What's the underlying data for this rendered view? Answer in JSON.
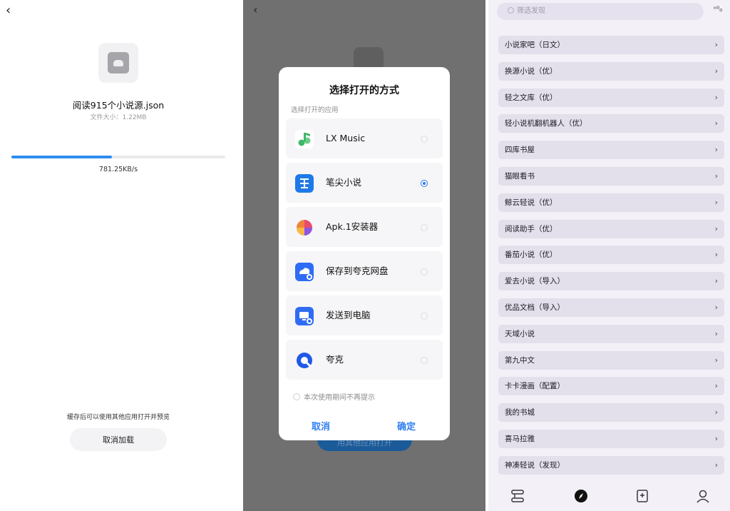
{
  "download": {
    "back_icon": "‹",
    "file_name": "阅读915个小说源.json",
    "file_size": "文件大小：1.22MB",
    "progress": 0.47,
    "speed": "781.25KB/s",
    "hint": "缓存后可以使用其他应用打开并预览",
    "cancel_label": "取消加载"
  },
  "chooser": {
    "back_icon": "‹",
    "background_button_label": "用其他应用打开",
    "title": "选择打开的方式",
    "subtitle": "选择打开的应用",
    "apps": [
      {
        "name": "LX Music",
        "icon": "lx-music-icon",
        "color": "#3fb76b",
        "selected": false
      },
      {
        "name": "笔尖小说",
        "icon": "bijian-novel-icon",
        "color": "#1f7ae8",
        "selected": true
      },
      {
        "name": "Apk.1安装器",
        "icon": "apk-installer-icon",
        "color": "#f0823c",
        "selected": false
      },
      {
        "name": "保存到夸克网盘",
        "icon": "quark-cloud-icon",
        "color": "#2f6cf5",
        "selected": false
      },
      {
        "name": "发送到电脑",
        "icon": "send-to-pc-icon",
        "color": "#2f6cf5",
        "selected": false
      },
      {
        "name": "夸克",
        "icon": "quark-icon",
        "color": "#1e59e8",
        "selected": false
      }
    ],
    "dont_show": "本次使用期间不再提示",
    "cancel": "取消",
    "confirm": "确定",
    "accent": "#2f7ef2"
  },
  "explore": {
    "search_placeholder": "筛选发现",
    "top_icon": "ᵒ⁰₀",
    "chevron": "›",
    "sources": [
      "小说家吧（日文）",
      "换源小说（优）",
      "轻之文库（优）",
      "轻小说机翻机器人（优）",
      "四库书屋",
      "猫眼看书",
      "鲸云轻说（优）",
      "阅读助手（优）",
      "番茄小说（优）",
      "爱去小说（导入）",
      "优品文档（导入）",
      "天域小说",
      "第九中文",
      "卡卡漫画（配置）",
      "我的书城",
      "喜马拉雅",
      "神凑轻说（发现）"
    ],
    "nav": [
      "bookshelf-icon",
      "compass-icon",
      "bookmark-icon",
      "profile-icon"
    ]
  }
}
